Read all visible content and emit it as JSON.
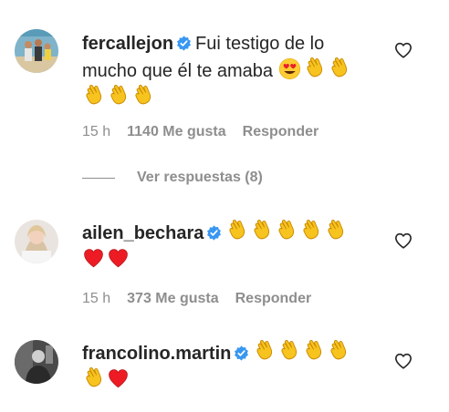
{
  "comments": [
    {
      "username": "fercallejon",
      "verified": true,
      "text_lines": [
        "Fui testigo de lo",
        "mucho que él te amaba"
      ],
      "emoji_line1": [
        "heart-eyes",
        "clap",
        "clap"
      ],
      "emoji_line2": [
        "clap",
        "clap",
        "clap"
      ],
      "time": "15 h",
      "likes": "1140 Me gusta",
      "reply_label": "Responder",
      "view_replies": "Ver respuestas (8)"
    },
    {
      "username": "ailen_bechara",
      "verified": true,
      "emoji_line1": [
        "clap",
        "clap",
        "clap",
        "clap",
        "clap"
      ],
      "emoji_line2": [
        "red-heart",
        "red-heart"
      ],
      "time": "15 h",
      "likes": "373 Me gusta",
      "reply_label": "Responder"
    },
    {
      "username": "francolino.martin",
      "verified": true,
      "emoji_line1": [
        "clap",
        "clap",
        "clap",
        "clap"
      ],
      "emoji_line2": [
        "clap",
        "red-heart"
      ]
    }
  ],
  "colors": {
    "text": "#262626",
    "secondary": "#8e8e8e",
    "verified_blue": "#3897f0",
    "heart_red": "#ed1c24",
    "clap_yellow": "#f7c31f"
  }
}
